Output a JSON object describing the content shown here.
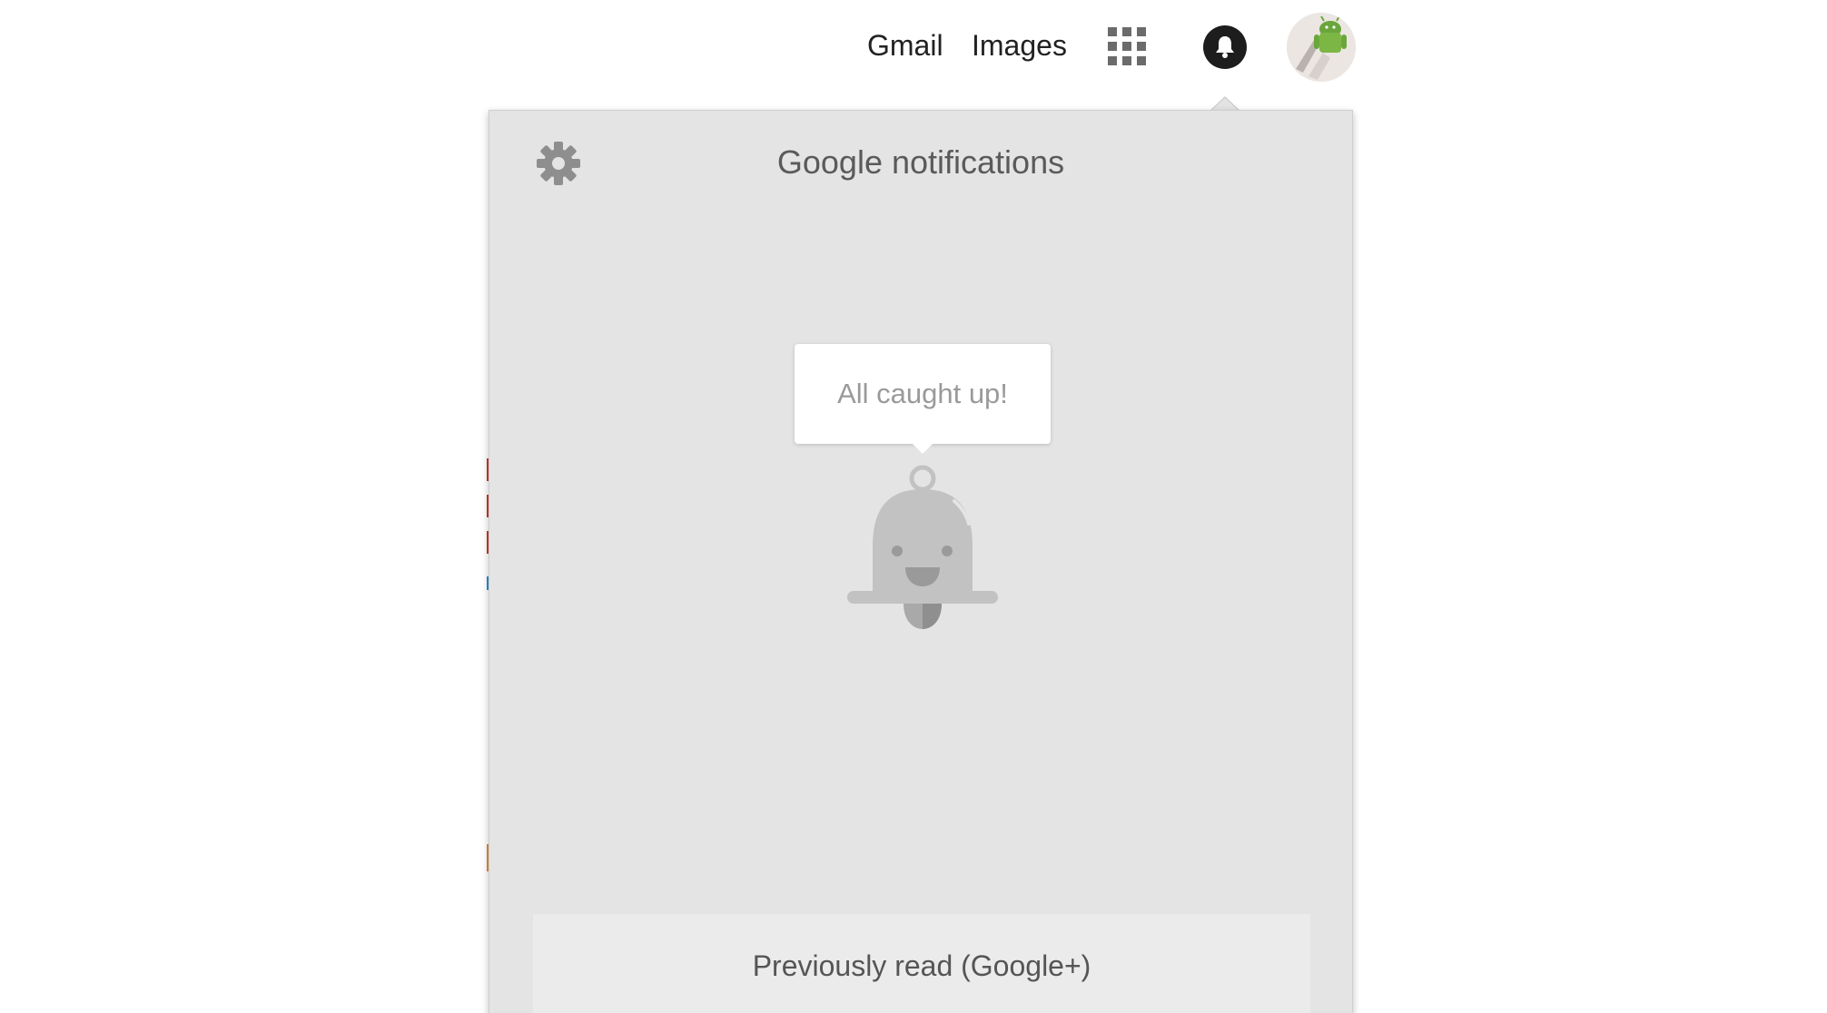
{
  "topbar": {
    "gmail_label": "Gmail",
    "images_label": "Images",
    "apps_icon": "apps-grid-icon",
    "notifications_icon": "bell-icon",
    "avatar_icon": "android-avatar"
  },
  "panel": {
    "title": "Google notifications",
    "settings_icon": "gear-icon",
    "empty_state_message": "All caught up!",
    "empty_state_icon": "smiling-bell-icon",
    "footer_link": "Previously read (Google+)"
  },
  "colors": {
    "panel_background": "#e4e4e4",
    "notification_button": "#1d1d1d",
    "muted_text": "#9a9a9a"
  }
}
